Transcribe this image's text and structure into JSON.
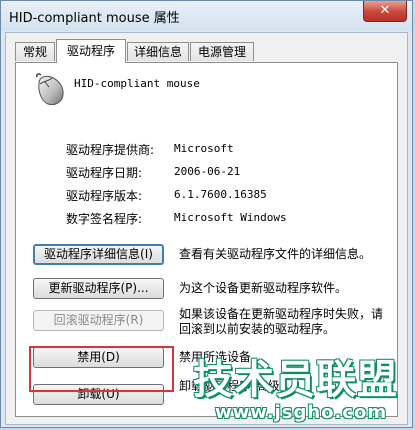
{
  "window": {
    "title": "HID-compliant mouse 属性",
    "close_glyph": "✕"
  },
  "tabs": [
    {
      "label": "常规",
      "active": false
    },
    {
      "label": "驱动程序",
      "active": true
    },
    {
      "label": "详细信息",
      "active": false
    },
    {
      "label": "电源管理",
      "active": false
    }
  ],
  "device": {
    "name": "HID-compliant mouse",
    "icon": "mouse-icon"
  },
  "info": [
    {
      "label": "驱动程序提供商:",
      "value": "Microsoft"
    },
    {
      "label": "驱动程序日期:",
      "value": "2006-06-21"
    },
    {
      "label": "驱动程序版本:",
      "value": "6.1.7600.16385"
    },
    {
      "label": "数字签名程序:",
      "value": "Microsoft Windows"
    }
  ],
  "actions": [
    {
      "button": "驱动程序详细信息(I)",
      "desc": "查看有关驱动程序文件的详细信息。",
      "enabled": true
    },
    {
      "button": "更新驱动程序(P)...",
      "desc": "为这个设备更新驱动程序软件。",
      "enabled": true
    },
    {
      "button": "回滚驱动程序(R)",
      "desc_line1": "如果该设备在更新驱动程序时失败，请",
      "desc_line2": "回滚到以前安装的驱动程序。",
      "enabled": false
    },
    {
      "button": "禁用(D)",
      "desc": "禁用所选设备。",
      "enabled": true
    },
    {
      "button": "卸载(U)",
      "desc": "卸载驱动程序(高级)。",
      "enabled": true
    }
  ],
  "watermark": {
    "brand": "技术员联盟",
    "url": "www.jsgho.com"
  },
  "colors": {
    "highlight": "#d9343a",
    "watermark": "#0c8f63"
  }
}
